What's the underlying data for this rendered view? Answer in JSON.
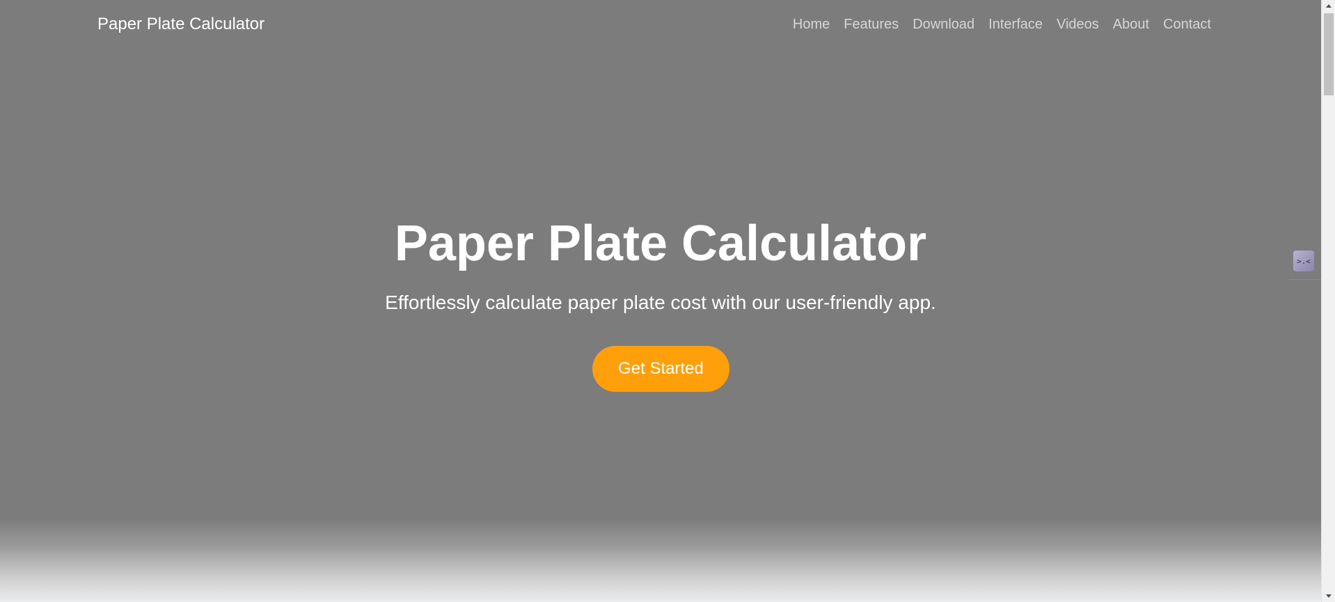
{
  "navbar": {
    "brand": "Paper Plate Calculator",
    "links": [
      {
        "label": "Home"
      },
      {
        "label": "Features"
      },
      {
        "label": "Download"
      },
      {
        "label": "Interface"
      },
      {
        "label": "Videos"
      },
      {
        "label": "About"
      },
      {
        "label": "Contact"
      }
    ]
  },
  "hero": {
    "title": "Paper Plate Calculator",
    "subtitle": "Effortlessly calculate paper plate cost with our user-friendly app.",
    "cta_label": "Get Started"
  },
  "side_widget": {
    "glyph": ">.<",
    "icon": "face-widget-icon"
  },
  "colors": {
    "hero_background": "#7c7c7c",
    "cta_background": "#ffa00a",
    "nav_link": "#d6d6d6",
    "text": "#ffffff"
  }
}
